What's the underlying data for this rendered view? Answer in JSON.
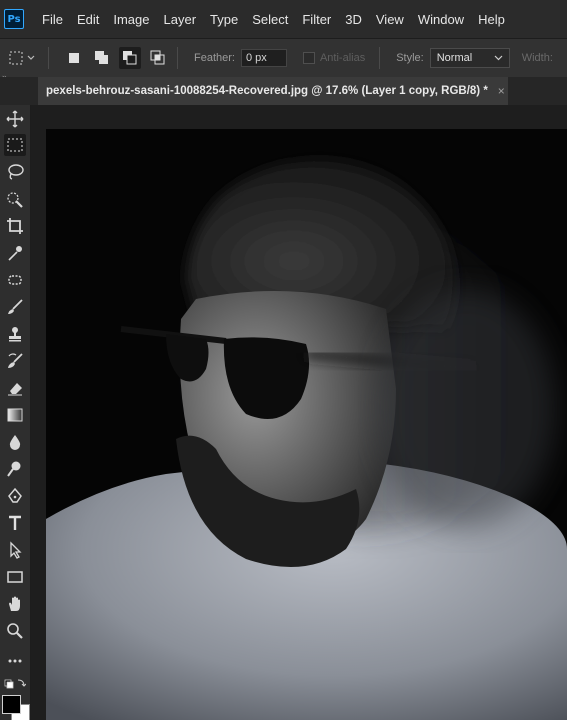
{
  "app": {
    "logo": "Ps"
  },
  "menu": [
    "File",
    "Edit",
    "Image",
    "Layer",
    "Type",
    "Select",
    "Filter",
    "3D",
    "View",
    "Window",
    "Help"
  ],
  "options": {
    "feather_label": "Feather:",
    "feather_value": "0 px",
    "antialias_label": "Anti-alias",
    "style_label": "Style:",
    "style_value": "Normal",
    "width_label": "Width:"
  },
  "document": {
    "tab_title": "pexels-behrouz-sasani-10088254-Recovered.jpg @ 17.6% (Layer 1 copy, RGB/8) *",
    "tab_close": "×"
  },
  "tools": [
    "move-tool-icon",
    "rectangular-marquee-tool-icon",
    "lasso-tool-icon",
    "quick-selection-tool-icon",
    "crop-tool-icon",
    "eyedropper-tool-icon",
    "spot-healing-brush-icon",
    "brush-tool-icon",
    "clone-stamp-tool-icon",
    "history-brush-icon",
    "eraser-tool-icon",
    "gradient-tool-icon",
    "blur-tool-icon",
    "dodge-tool-icon",
    "pen-tool-icon",
    "type-tool-icon",
    "path-selection-tool-icon",
    "rectangle-tool-icon",
    "hand-tool-icon",
    "zoom-tool-icon",
    "more-tools-icon"
  ],
  "colors": {
    "accent": "#31a8ff",
    "menubar": "#2b2b2b",
    "optionsbar": "#323232",
    "canvas_bg": "#050505"
  }
}
